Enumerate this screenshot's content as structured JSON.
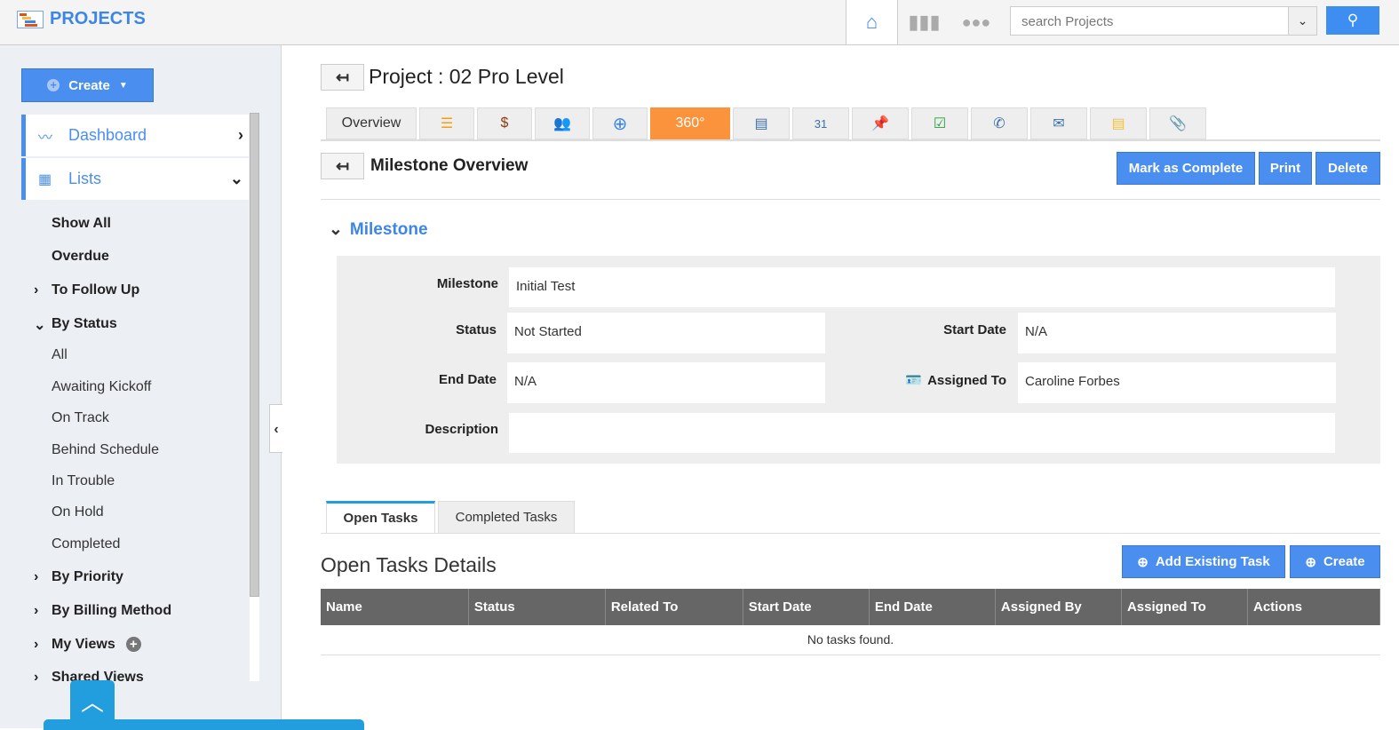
{
  "header": {
    "brand": "PROJECTS",
    "search_placeholder": "search Projects"
  },
  "sidebar": {
    "create_label": "Create",
    "dashboard": "Dashboard",
    "lists": "Lists",
    "items": [
      {
        "label": "Show All",
        "bold": true
      },
      {
        "label": "Overdue",
        "bold": true
      },
      {
        "label": "To Follow Up",
        "bold": true,
        "arrow": "›"
      },
      {
        "label": "By Status",
        "bold": true,
        "arrow": "⌄"
      },
      {
        "label": "All"
      },
      {
        "label": "Awaiting Kickoff"
      },
      {
        "label": "On Track"
      },
      {
        "label": "Behind Schedule"
      },
      {
        "label": "In Trouble"
      },
      {
        "label": "On Hold"
      },
      {
        "label": "Completed"
      },
      {
        "label": "By Priority",
        "bold": true,
        "arrow": "›"
      },
      {
        "label": "By Billing Method",
        "bold": true,
        "arrow": "›"
      },
      {
        "label": "My Views",
        "bold": true,
        "arrow": "›"
      },
      {
        "label": "Shared Views",
        "bold": true,
        "arrow": "›"
      }
    ]
  },
  "page": {
    "title": "Project : 02 Pro Level",
    "overview_tab": "Overview",
    "tab_360": "360°",
    "section_title": "Milestone Overview",
    "buttons": {
      "complete": "Mark as Complete",
      "print": "Print",
      "delete": "Delete"
    },
    "milestone_section": "Milestone",
    "fields": {
      "milestone_label": "Milestone",
      "milestone": "Initial Test",
      "status_label": "Status",
      "status": "Not Started",
      "start_label": "Start Date",
      "start": "N/A",
      "end_label": "End Date",
      "end": "N/A",
      "assigned_label": "Assigned To",
      "assigned": "Caroline Forbes",
      "desc_label": "Description",
      "desc": ""
    },
    "task_tabs": {
      "open": "Open Tasks",
      "completed": "Completed Tasks"
    },
    "tasks_title": "Open Tasks Details",
    "add_existing": "Add Existing Task",
    "create": "Create",
    "columns": [
      "Name",
      "Status",
      "Related To",
      "Start Date",
      "End Date",
      "Assigned By",
      "Assigned To",
      "Actions"
    ],
    "empty": "No tasks found."
  },
  "colors": {
    "accent": "#4a8ef0",
    "orange": "#fb923c",
    "header_row": "#666666"
  }
}
